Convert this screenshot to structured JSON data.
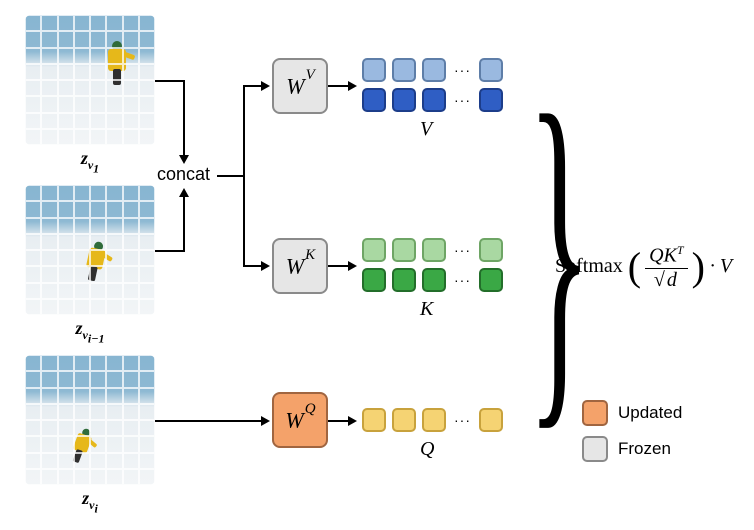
{
  "frames": {
    "v1_label_html": "z<sub>v<sub>1</sub></sub>",
    "vim1_label_html": "z<sub>v<sub>i−1</sub></sub>",
    "vi_label_html": "z<sub>v<sub>i</sub></sub>"
  },
  "concat_label": "concat",
  "weights": {
    "wv_html": "W<sup>V</sup>",
    "wk_html": "W<sup>K</sup>",
    "wq_html": "W<sup>Q</sup>"
  },
  "groups": {
    "v_label": "V",
    "k_label": "K",
    "q_label": "Q",
    "ellipsis": "···"
  },
  "formula": {
    "fn": "Softmax",
    "num_html": "QK<sup>T</sup>",
    "den_d": "d",
    "tail": "· V"
  },
  "legend": {
    "updated": "Updated",
    "frozen": "Frozen"
  }
}
